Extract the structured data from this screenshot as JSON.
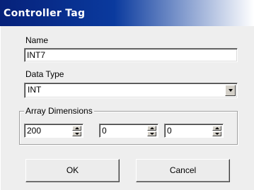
{
  "window": {
    "title": "Controller Tag"
  },
  "form": {
    "name_label": "Name",
    "name_value": "INT7",
    "data_type_label": "Data Type",
    "data_type_value": "INT",
    "array_dimensions": {
      "legend": "Array Dimensions",
      "dims": [
        "200",
        "0",
        "0"
      ]
    }
  },
  "buttons": {
    "ok_label": "OK",
    "cancel_label": "Cancel"
  },
  "colors": {
    "titlebar_start": "#06217a",
    "titlebar_end": "#ffffff",
    "dialog_bg": "#eeeeee"
  },
  "icons": {
    "dropdown": "chevron-down-icon",
    "spin_up": "arrow-up-icon",
    "spin_down": "arrow-down-icon"
  }
}
